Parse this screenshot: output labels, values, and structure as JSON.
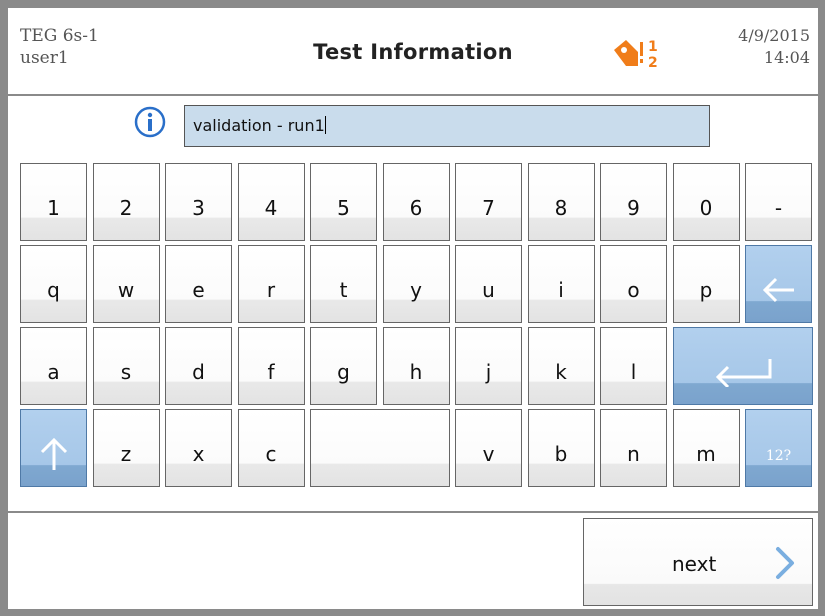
{
  "header": {
    "device": "TEG 6s-1",
    "user": "user1",
    "title": "Test Information",
    "date": "4/9/2015",
    "time": "14:04",
    "icon": "step-1-2-tag-icon"
  },
  "input": {
    "info_icon": "info-icon",
    "value": "validation - run1"
  },
  "keyboard": {
    "row1": [
      "1",
      "2",
      "3",
      "4",
      "5",
      "6",
      "7",
      "8",
      "9",
      "0",
      "-"
    ],
    "row2": [
      "q",
      "w",
      "e",
      "r",
      "t",
      "y",
      "u",
      "i",
      "o",
      "p"
    ],
    "row3": [
      "a",
      "s",
      "d",
      "f",
      "g",
      "h",
      "j",
      "k",
      "l"
    ],
    "row4": [
      "z",
      "x",
      "c",
      "v",
      "b",
      "n",
      "m"
    ],
    "numbers_toggle": "12?",
    "backspace_icon": "backspace-arrow-icon",
    "enter_icon": "enter-icon",
    "shift_icon": "shift-up-arrow-icon",
    "space_icon": "space-bar"
  },
  "footer": {
    "next_label": "next",
    "next_icon": "chevron-right-icon"
  },
  "colors": {
    "accent_key": "#a6c7e8",
    "field_bg": "#c9dcec",
    "info_blue": "#2a6fc9",
    "warning_orange": "#f07d1a"
  }
}
